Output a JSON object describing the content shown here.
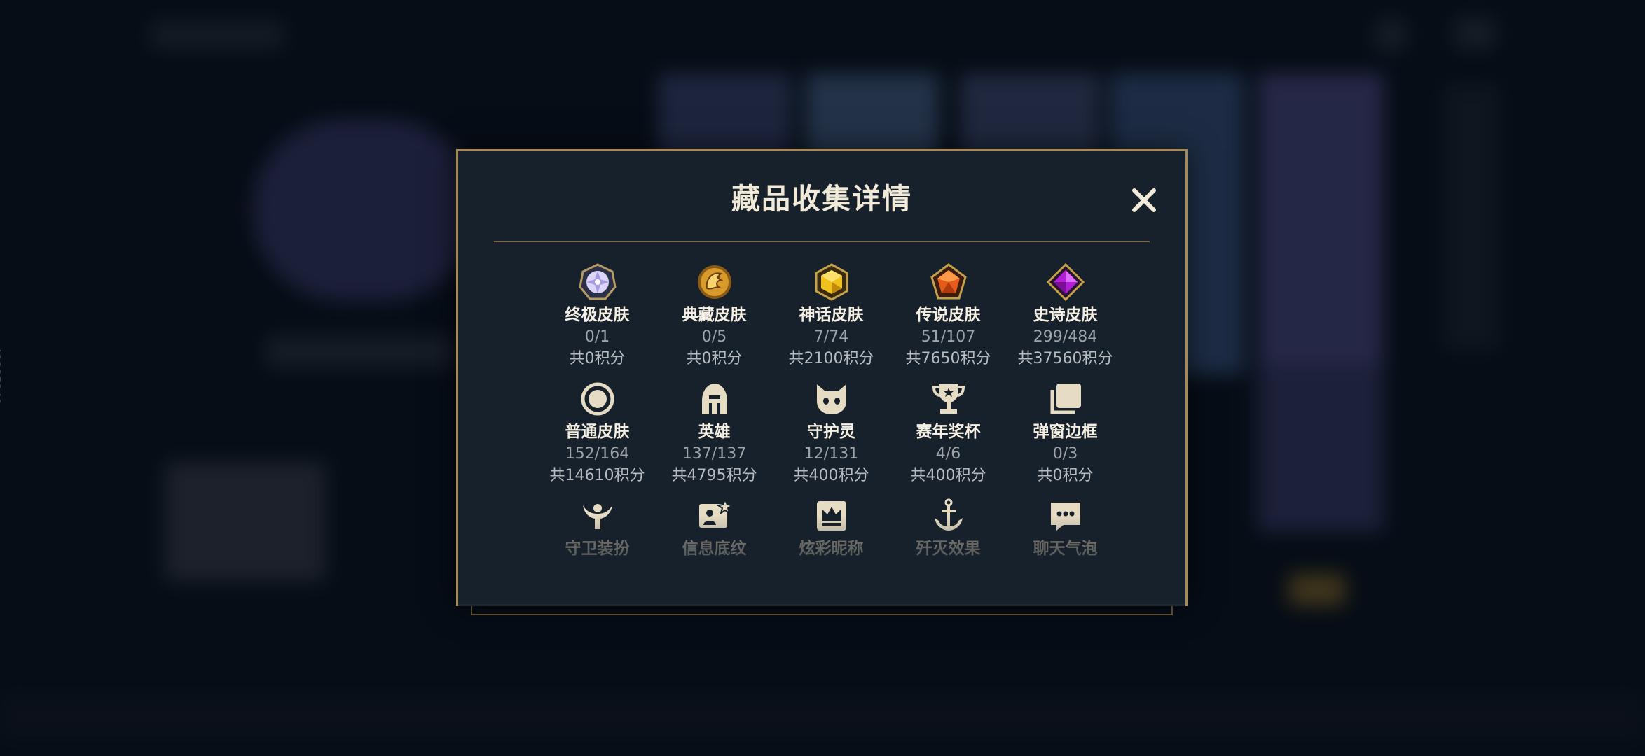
{
  "modal": {
    "title": "藏品收集详情",
    "close_icon": "close-x-icon",
    "rows": [
      [
        {
          "label": "终极皮肤",
          "count": "0/1",
          "score": "共0积分",
          "icon": "ultimate-gem-icon"
        },
        {
          "label": "典藏皮肤",
          "count": "0/5",
          "score": "共0积分",
          "icon": "dragon-emblem-icon"
        },
        {
          "label": "神话皮肤",
          "count": "7/74",
          "score": "共2100积分",
          "icon": "mythic-gem-icon"
        },
        {
          "label": "传说皮肤",
          "count": "51/107",
          "score": "共7650积分",
          "icon": "legendary-gem-icon"
        },
        {
          "label": "史诗皮肤",
          "count": "299/484",
          "score": "共37560积分",
          "icon": "epic-gem-icon"
        }
      ],
      [
        {
          "label": "普通皮肤",
          "count": "152/164",
          "score": "共14610积分",
          "icon": "ring-icon"
        },
        {
          "label": "英雄",
          "count": "137/137",
          "score": "共4795积分",
          "icon": "helmet-icon"
        },
        {
          "label": "守护灵",
          "count": "12/131",
          "score": "共400积分",
          "icon": "little-legend-icon"
        },
        {
          "label": "赛年奖杯",
          "count": "4/6",
          "score": "共400积分",
          "icon": "trophy-icon"
        },
        {
          "label": "弹窗边框",
          "count": "0/3",
          "score": "共0积分",
          "icon": "frames-icon"
        }
      ],
      [
        {
          "label": "守卫装扮",
          "icon": "ward-skin-icon"
        },
        {
          "label": "信息底纹",
          "icon": "profile-banner-icon"
        },
        {
          "label": "炫彩昵称",
          "icon": "crown-card-icon"
        },
        {
          "label": "歼灭效果",
          "icon": "anchor-icon"
        },
        {
          "label": "聊天气泡",
          "icon": "chat-bubble-icon"
        }
      ]
    ]
  },
  "side_id": "42237249",
  "colors": {
    "gold": "#a8894f",
    "panel": "#17212b",
    "text": "#f4efe2"
  }
}
